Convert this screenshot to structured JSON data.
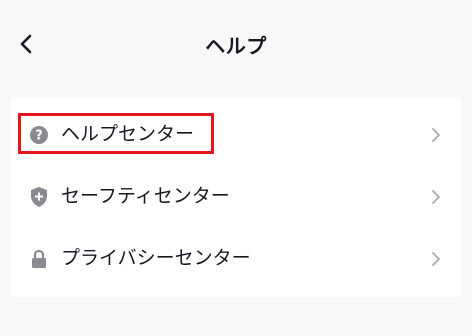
{
  "header": {
    "title": "ヘルプ",
    "back_icon": "chevron-left-icon"
  },
  "menu": {
    "items": [
      {
        "label": "ヘルプセンター",
        "icon": "question-circle-icon",
        "highlighted": true
      },
      {
        "label": "セーフティセンター",
        "icon": "shield-plus-icon",
        "highlighted": false
      },
      {
        "label": "プライバシーセンター",
        "icon": "lock-icon",
        "highlighted": false
      }
    ]
  },
  "colors": {
    "background": "#f7f7f7",
    "card": "#ffffff",
    "text": "#161823",
    "icon": "#8a8b91",
    "chevron": "#a9aab0",
    "highlight": "#e8141c"
  }
}
